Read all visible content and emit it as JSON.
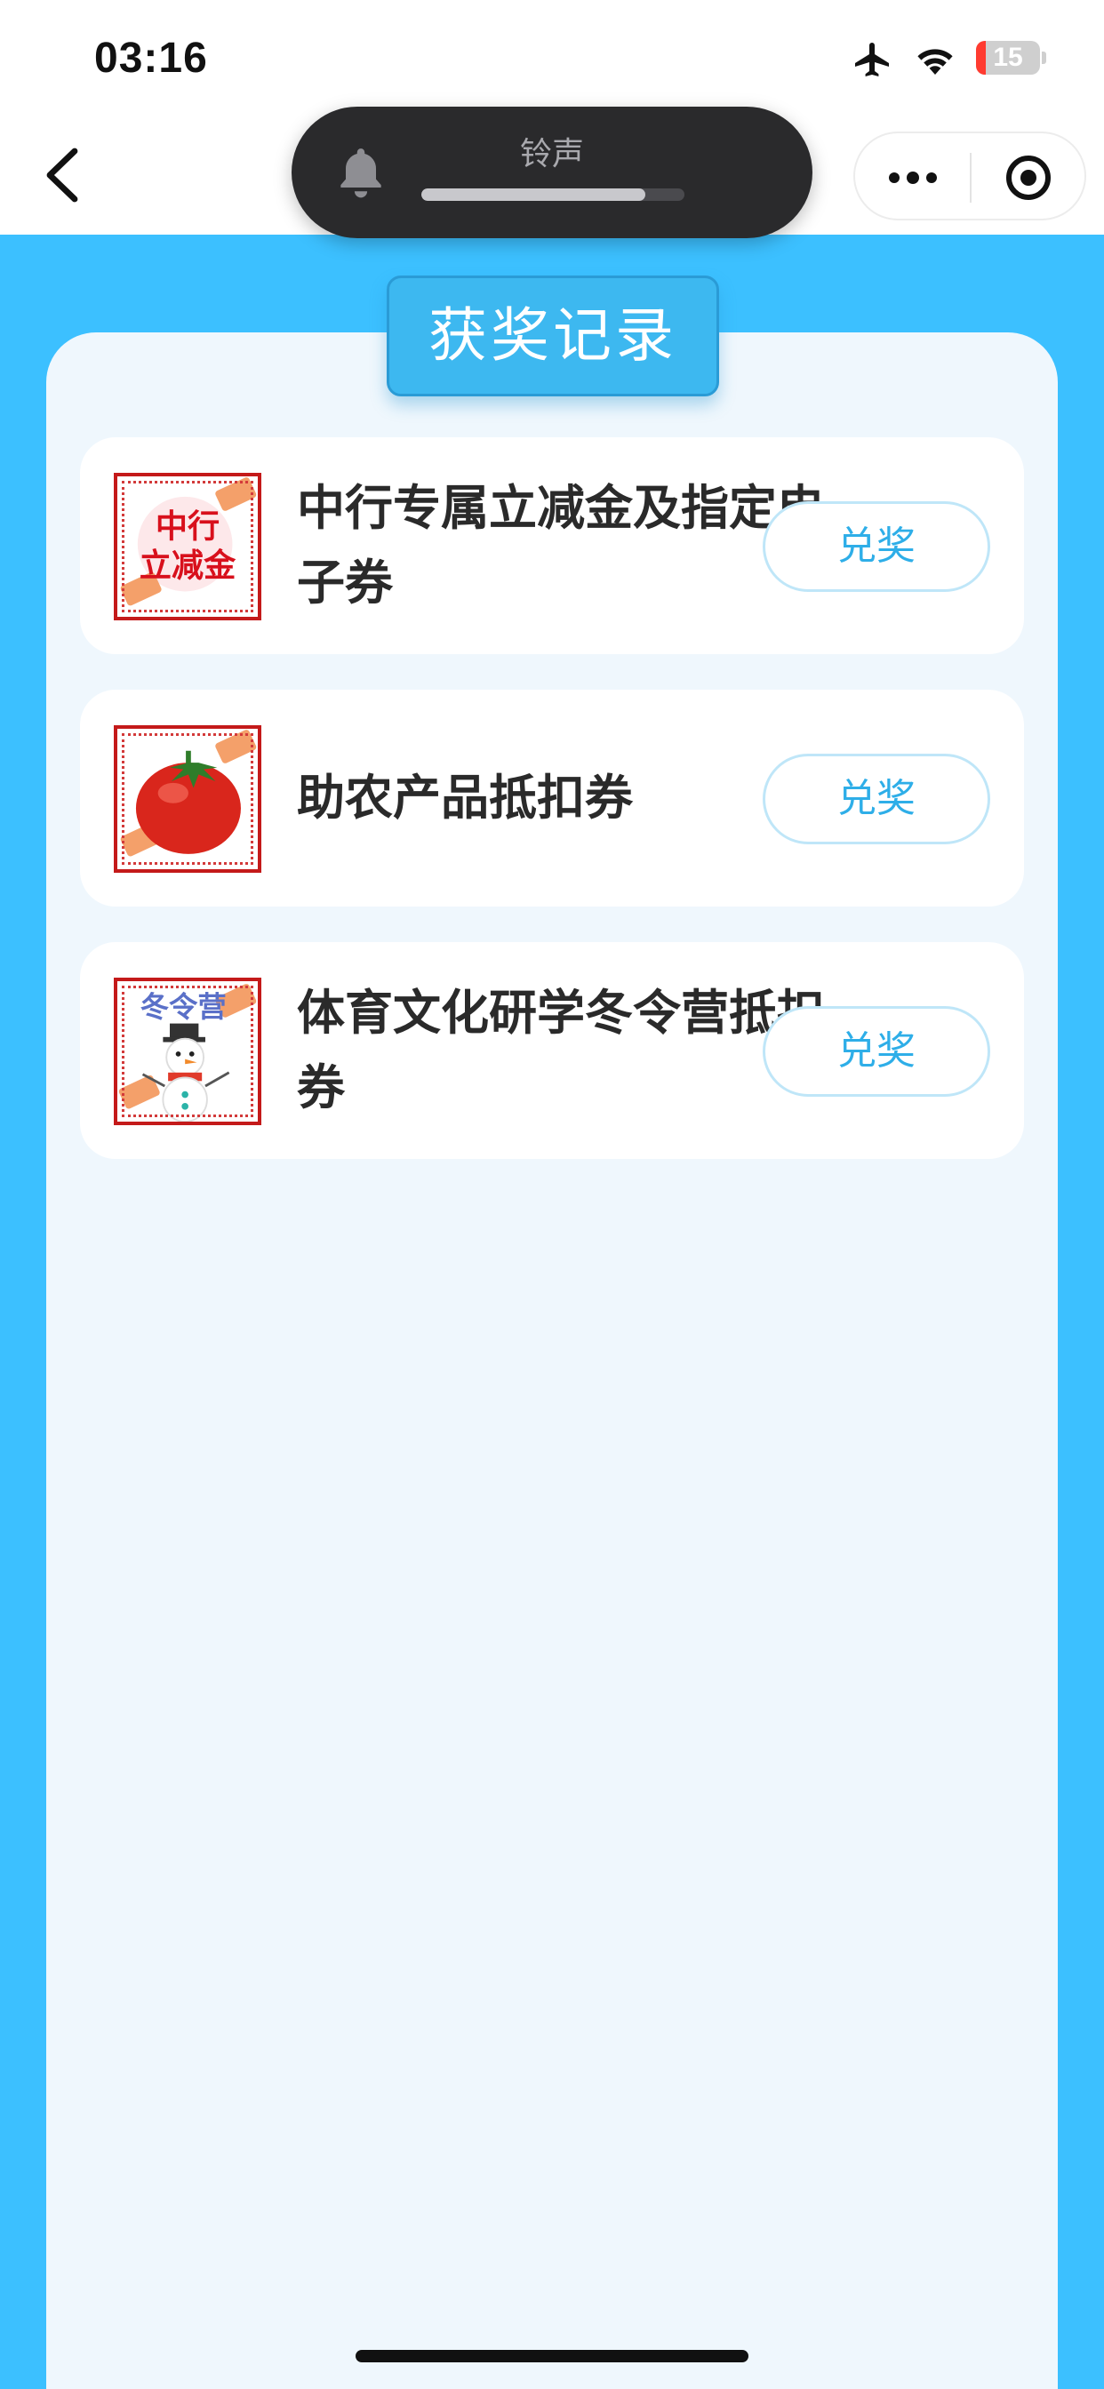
{
  "status_bar": {
    "time": "03:16",
    "battery_level": "15",
    "battery_fraction": 0.15,
    "battery_color": "#ff3b30",
    "icons": [
      "airplane-mode-icon",
      "wifi-icon",
      "battery-icon"
    ]
  },
  "ringer_hud": {
    "title": "铃声",
    "volume_fraction": 0.85,
    "icon": "bell-icon"
  },
  "nav": {
    "back_icon": "chevron-left-icon",
    "capsule_icons": [
      "more-dots-icon",
      "close-target-icon"
    ]
  },
  "page": {
    "title": "获奖记录",
    "accent_color": "#3cc0ff"
  },
  "prizes": [
    {
      "name": "中行专属立减金及指定电子券",
      "thumb_text": [
        "中行",
        "立减金"
      ],
      "button_label": "兑奖"
    },
    {
      "name": "助农产品抵扣券",
      "thumb_icon": "tomato-icon",
      "button_label": "兑奖"
    },
    {
      "name": "体育文化研学冬令营抵扣券",
      "thumb_text": [
        "冬令营"
      ],
      "thumb_icon": "snowman-icon",
      "button_label": "兑奖"
    }
  ]
}
